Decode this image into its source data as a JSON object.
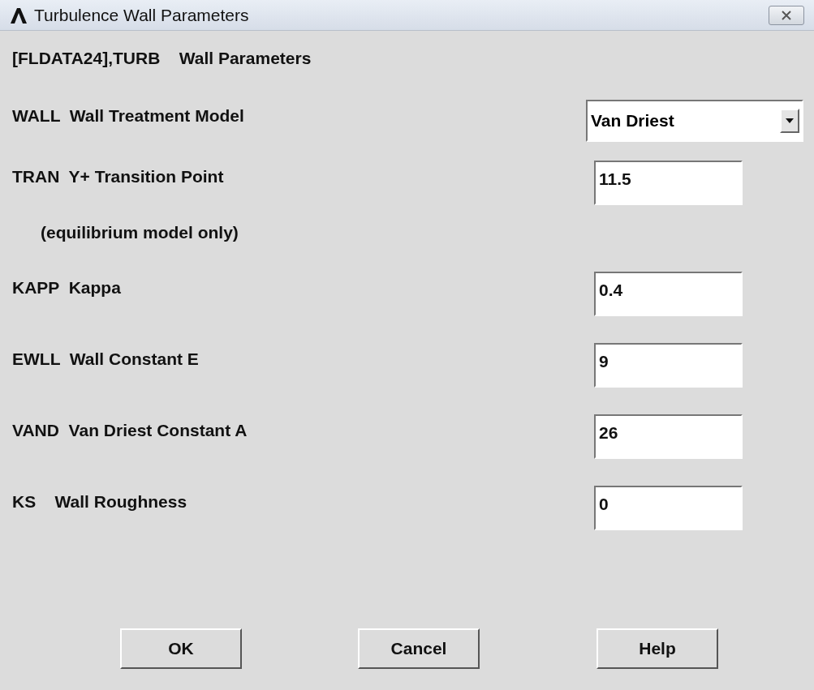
{
  "window": {
    "title": "Turbulence Wall Parameters"
  },
  "header": "[FLDATA24],TURB    Wall Parameters",
  "fields": [
    {
      "kind": "select",
      "label": "WALL  Wall Treatment Model",
      "value": "Van Driest"
    },
    {
      "kind": "text",
      "label": "TRAN  Y+ Transition Point",
      "value": "11.5"
    },
    {
      "kind": "note",
      "label": "(equilibrium model only)"
    },
    {
      "kind": "text",
      "label": "KAPP  Kappa",
      "value": "0.4"
    },
    {
      "kind": "text",
      "label": "EWLL  Wall Constant E",
      "value": "9"
    },
    {
      "kind": "text",
      "label": "VAND  Van Driest Constant A",
      "value": "26"
    },
    {
      "kind": "text",
      "label": "KS    Wall Roughness",
      "value": "0"
    }
  ],
  "buttons": [
    "OK",
    "Cancel",
    "Help"
  ]
}
